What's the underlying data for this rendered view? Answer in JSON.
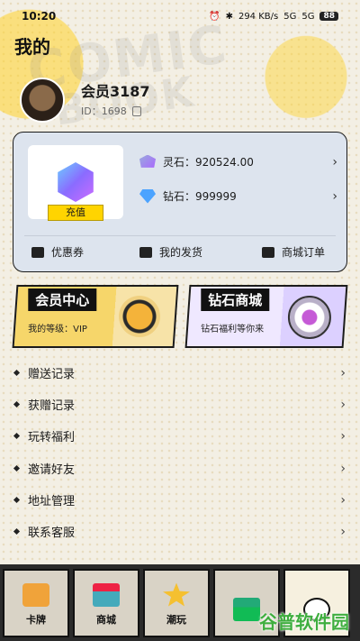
{
  "status_bar": {
    "time": "10:20",
    "net_speed": "294 KB/s",
    "signal1": "5G",
    "signal2": "5G",
    "battery": "88"
  },
  "page": {
    "title": "我的"
  },
  "profile": {
    "username": "会员3187",
    "id_text": "ID：1698"
  },
  "wallet": {
    "recharge_label": "充值",
    "spirit_stone": "灵石：920524.00",
    "diamond": "钻石：999999",
    "quick_links": [
      "优惠券",
      "我的发货",
      "商城订单"
    ]
  },
  "banners": {
    "member": {
      "title": "会员中心",
      "subtitle": "我的等级：VIP"
    },
    "diamond_mall": {
      "title": "钻石商城",
      "subtitle": "钻石福利等你来"
    }
  },
  "menu": [
    "赠送记录",
    "获赠记录",
    "玩转福利",
    "邀请好友",
    "地址管理",
    "联系客服"
  ],
  "tabs": [
    "卡牌",
    "商城",
    "潮玩",
    "",
    ""
  ],
  "watermark": "谷普软件园",
  "colors": {
    "accent": "#ffd400",
    "card_bg": "#dde4ee",
    "tabbar_bg": "#2b2b2b"
  }
}
